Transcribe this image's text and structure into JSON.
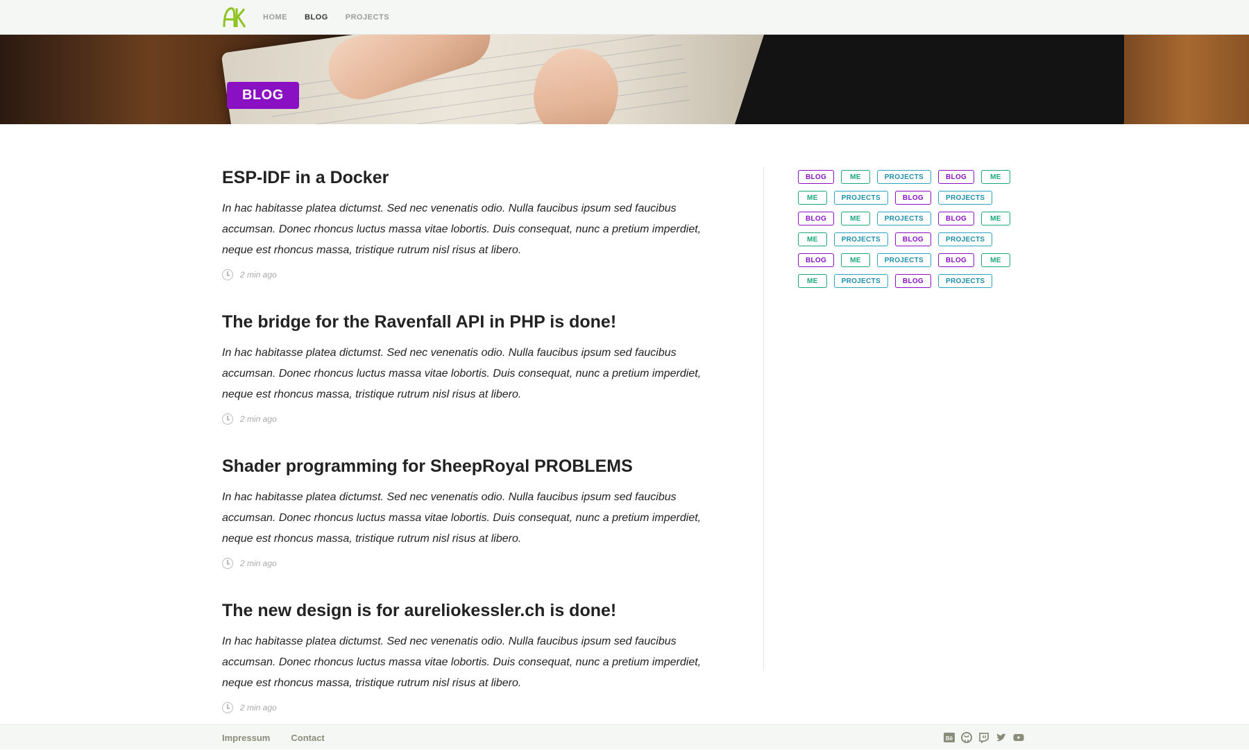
{
  "brand": {
    "logo_text": "AK",
    "accent": "#8dc21f"
  },
  "nav": {
    "items": [
      {
        "label": "HOME",
        "active": false
      },
      {
        "label": "BLOG",
        "active": true
      },
      {
        "label": "PROJECTS",
        "active": false
      }
    ]
  },
  "hero": {
    "badge": "BLOG",
    "badge_color": "#8a10c4"
  },
  "posts": [
    {
      "title": "ESP-IDF in a Docker",
      "excerpt": "In hac habitasse platea dictumst. Sed nec venenatis odio. Nulla faucibus ipsum sed faucibus accumsan. Donec rhoncus luctus massa vitae lobortis. Duis consequat, nunc a pretium imperdiet, neque est rhoncus massa, tristique rutrum nisl risus at libero.",
      "time": "2 min ago"
    },
    {
      "title": "The bridge for the Ravenfall API in PHP is done!",
      "excerpt": "In hac habitasse platea dictumst. Sed nec venenatis odio. Nulla faucibus ipsum sed faucibus accumsan. Donec rhoncus luctus massa vitae lobortis. Duis consequat, nunc a pretium imperdiet, neque est rhoncus massa, tristique rutrum nisl risus at libero.",
      "time": "2 min ago"
    },
    {
      "title": "Shader programming for SheepRoyal PROBLEMS",
      "excerpt": "In hac habitasse platea dictumst. Sed nec venenatis odio. Nulla faucibus ipsum sed faucibus accumsan. Donec rhoncus luctus massa vitae lobortis. Duis consequat, nunc a pretium imperdiet, neque est rhoncus massa, tristique rutrum nisl risus at libero.",
      "time": "2 min ago"
    },
    {
      "title": "The new design is for aureliokessler.ch is done!",
      "excerpt": "In hac habitasse platea dictumst. Sed nec venenatis odio. Nulla faucibus ipsum sed faucibus accumsan. Donec rhoncus luctus massa vitae lobortis. Duis consequat, nunc a pretium imperdiet, neque est rhoncus massa, tristique rutrum nisl risus at libero.",
      "time": "2 min ago"
    }
  ],
  "tags": {
    "rows": [
      [
        "BLOG",
        "ME",
        "PROJECTS",
        "BLOG",
        "ME"
      ],
      [
        "ME",
        "PROJECTS",
        "BLOG",
        "PROJECTS"
      ],
      [
        "BLOG",
        "ME",
        "PROJECTS",
        "BLOG",
        "ME"
      ],
      [
        "ME",
        "PROJECTS",
        "BLOG",
        "PROJECTS"
      ],
      [
        "BLOG",
        "ME",
        "PROJECTS",
        "BLOG",
        "ME"
      ],
      [
        "ME",
        "PROJECTS",
        "BLOG",
        "PROJECTS"
      ]
    ],
    "colors": {
      "BLOG": "#8a10c4",
      "ME": "#19a77a",
      "PROJECTS": "#2aa6c0"
    }
  },
  "footer": {
    "links": [
      "Impressum",
      "Contact"
    ],
    "social_icons": [
      "behance-icon",
      "github-icon",
      "twitch-icon",
      "twitter-icon",
      "youtube-icon"
    ]
  }
}
